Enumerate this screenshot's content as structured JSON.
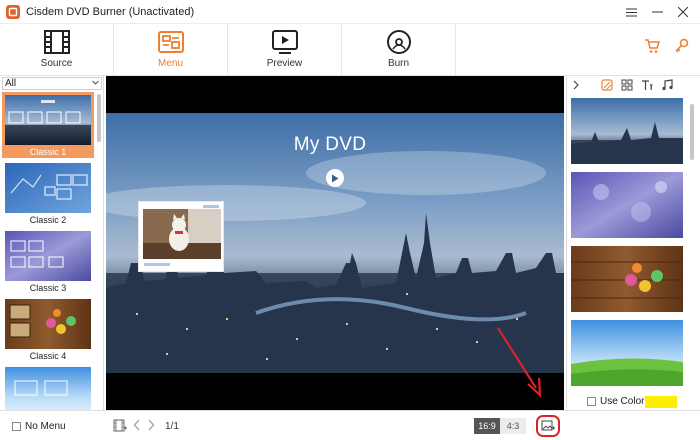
{
  "window": {
    "title": "Cisdem DVD Burner (Unactivated)"
  },
  "tabs": [
    {
      "label": "Source",
      "icon": "film-icon",
      "active": false
    },
    {
      "label": "Menu",
      "icon": "menu-layout-icon",
      "active": true
    },
    {
      "label": "Preview",
      "icon": "play-screen-icon",
      "active": false
    },
    {
      "label": "Burn",
      "icon": "disc-icon",
      "active": false
    }
  ],
  "toolbar_right": {
    "cart_icon": "cart-icon",
    "key_icon": "key-icon"
  },
  "template_filter": {
    "value": "All"
  },
  "templates": [
    {
      "label": "Classic 1",
      "selected": true
    },
    {
      "label": "Classic 2",
      "selected": false
    },
    {
      "label": "Classic 3",
      "selected": false
    },
    {
      "label": "Classic 4",
      "selected": false
    },
    {
      "label": "",
      "selected": false
    }
  ],
  "preview": {
    "dvd_title": "My DVD"
  },
  "right_panel": {
    "tabs": [
      "background-icon",
      "layout-icon",
      "text-icon",
      "music-icon"
    ],
    "use_color_label": "Use Color",
    "color": "#ffee00"
  },
  "bottom": {
    "no_menu_label": "No Menu",
    "page_count": "1/1",
    "ratio_169": "16:9",
    "ratio_43": "4:3"
  },
  "colors": {
    "accent": "#ef7e33",
    "selected_template": "#f39a5e",
    "highlight": "#d8232a"
  }
}
